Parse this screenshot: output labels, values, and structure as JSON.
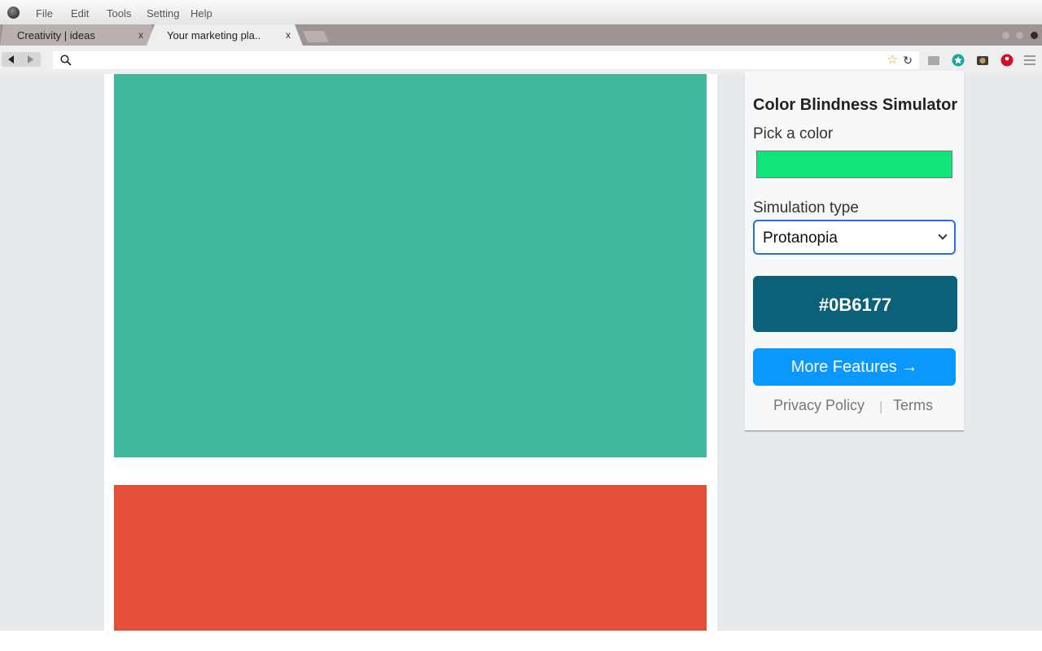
{
  "menubar": {
    "items": [
      "File",
      "Edit",
      "Tools",
      "Setting",
      "Help"
    ]
  },
  "tabs": [
    {
      "title": "Creativity  |  ideas",
      "close": "x",
      "active": false
    },
    {
      "title": "Your marketing pla..",
      "close": "x",
      "active": true
    }
  ],
  "toolbar": {
    "url": "",
    "extensions": [
      "gray-square-icon",
      "teal-star-icon",
      "camera-icon",
      "red-circle-icon",
      "hamburger-menu-icon"
    ]
  },
  "page": {
    "blocks": [
      {
        "name": "green-block",
        "color": "#40b89e"
      },
      {
        "name": "red-block",
        "color": "#e34f3b"
      }
    ]
  },
  "popup": {
    "title": "Color Blindness Simulator",
    "pick_label": "Pick a color",
    "picked_color": "#10e47a",
    "simulation_label": "Simulation type",
    "simulation_value": "Protanopia",
    "result_hex": "#0B6177",
    "result_color": "#0b6177",
    "more_button": "More Features →",
    "more_button_color": "#0a98ff",
    "privacy_link": "Privacy Policy",
    "separator": "|",
    "terms_link": "Terms"
  },
  "colors": {
    "tabstrip": "#9d9493",
    "page_background": "#e6eaed",
    "select_focus": "#2b6fd6"
  }
}
